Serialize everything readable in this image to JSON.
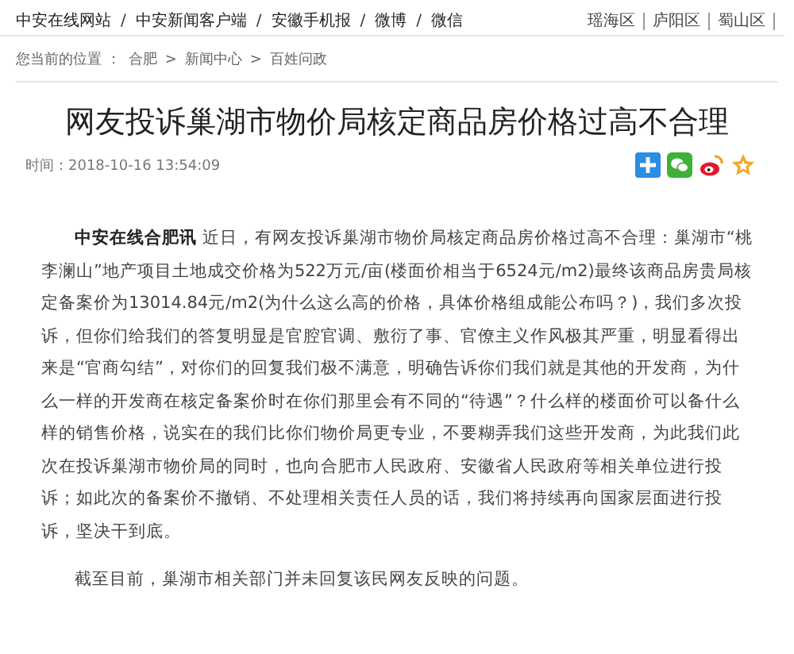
{
  "top_nav": {
    "separator": "/",
    "links": [
      "中安在线网站",
      "中安新闻客户端",
      "安徽手机报",
      "微博",
      "微信"
    ],
    "districts": [
      "瑶海区",
      "庐阳区",
      "蜀山区"
    ]
  },
  "breadcrumb": {
    "label": "您当前的位置 ：",
    "separator": ">",
    "items": [
      "合肥",
      "新闻中心",
      "百姓问政"
    ]
  },
  "article": {
    "title": "网友投诉巢湖市物价局核定商品房价格过高不合理",
    "time": "时间：2018-10-16 13:54:09",
    "paragraphs": [
      "**中安在线合肥讯** 近日，有网友投诉巢湖市物价局核定商品房价格过高不合理：巢湖市“桃李澜山”地产项目土地成交价格为522万元/亩(楼面价相当于6524元/m2)最终该商品房贵局核定备案价为13014.84元/m2(为什么这么高的价格，具体价格组成能公布吗？)，我们多次投诉，但你们给我们的答复明显是官腔官调、敷衍了事、官僚主义作风极其严重，明显看得出来是“官商勾结”，对你们的回复我们极不满意，明确告诉你们我们就是其他的开发商，为什么一样的开发商在核定备案价时在你们那里会有不同的“待遇”？什么样的楼面价可以备什么样的销售价格，说实在的我们比你们物价局更专业，不要糊弄我们这些开发商，为此我们此次在投诉巢湖市物价局的同时，也向合肥市人民政府、安徽省人民政府等相关单位进行投诉；如此次的备案价不撤销、不处理相关责任人员的话，我们将持续再向国家层面进行投诉，坚决干到底。",
      "截至目前，巢湖市相关部门并未回复该民网友反映的问题。"
    ]
  }
}
